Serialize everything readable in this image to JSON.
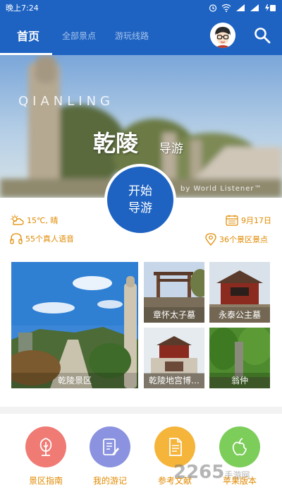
{
  "status_bar": {
    "time": "晚上7:24"
  },
  "nav": {
    "tabs": [
      {
        "label": "首页",
        "active": true
      },
      {
        "label": "全部景点",
        "active": false
      },
      {
        "label": "游玩线路",
        "active": false
      }
    ]
  },
  "banner": {
    "pinyin": "QIANLING",
    "title": "乾陵",
    "subtitle": "导游",
    "byline": "by World Listener™"
  },
  "start_button": {
    "line1": "开始",
    "line2": "导游"
  },
  "info": {
    "weather": "15℃, 晴",
    "date": "9月17日",
    "voices": "55个真人语音",
    "spots": "36个景区景点"
  },
  "photos": [
    {
      "label": "乾陵景区"
    },
    {
      "label": "章怀太子墓"
    },
    {
      "label": "永泰公主墓"
    },
    {
      "label": "乾陵地宫博…"
    },
    {
      "label": "翁仲"
    }
  ],
  "menu": [
    {
      "label": "景区指南",
      "color": "#f07a74"
    },
    {
      "label": "我的游记",
      "color": "#8b93e0"
    },
    {
      "label": "参考文献",
      "color": "#f5b43a"
    },
    {
      "label": "苹果版本",
      "color": "#7ccd5a"
    }
  ],
  "watermark": {
    "main": "2265",
    "sub": "手游网"
  },
  "colors": {
    "primary": "#1e63c2",
    "accent": "#e08a00"
  }
}
